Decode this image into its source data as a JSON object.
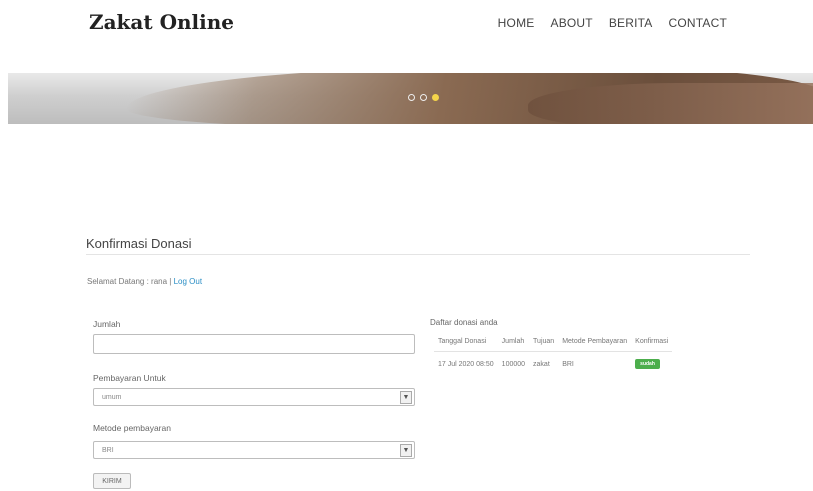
{
  "brand": "Zakat Online",
  "nav": [
    "HOME",
    "ABOUT",
    "BERITA",
    "CONTACT"
  ],
  "section": {
    "title": "Konfirmasi Donasi",
    "welcome_prefix": "Selamat Datang : rana | ",
    "logout": "Log Out"
  },
  "form": {
    "jumlah_label": "Jumlah",
    "jumlah_value": "",
    "pembayaran_label": "Pembayaran Untuk",
    "pembayaran_value": "umum",
    "metode_label": "Metode pembayaran",
    "metode_value": "BRI",
    "submit": "KIRIM"
  },
  "donasi": {
    "caption": "Daftar donasi anda",
    "headers": [
      "Tanggal Donasi",
      "Jumlah",
      "Tujuan",
      "Metode Pembayaran",
      "Konfirmasi"
    ],
    "rows": [
      {
        "tanggal": "17 Jul 2020 08:50",
        "jumlah": "100000",
        "tujuan": "zakat",
        "metode": "BRI",
        "konfirmasi": "sudah"
      }
    ]
  },
  "colors": {
    "accent_link": "#2a8ec5",
    "badge": "#4cae4c",
    "slider_active": "#f5d44a"
  },
  "icons": {
    "select_arrow": "chevron-down-icon"
  }
}
